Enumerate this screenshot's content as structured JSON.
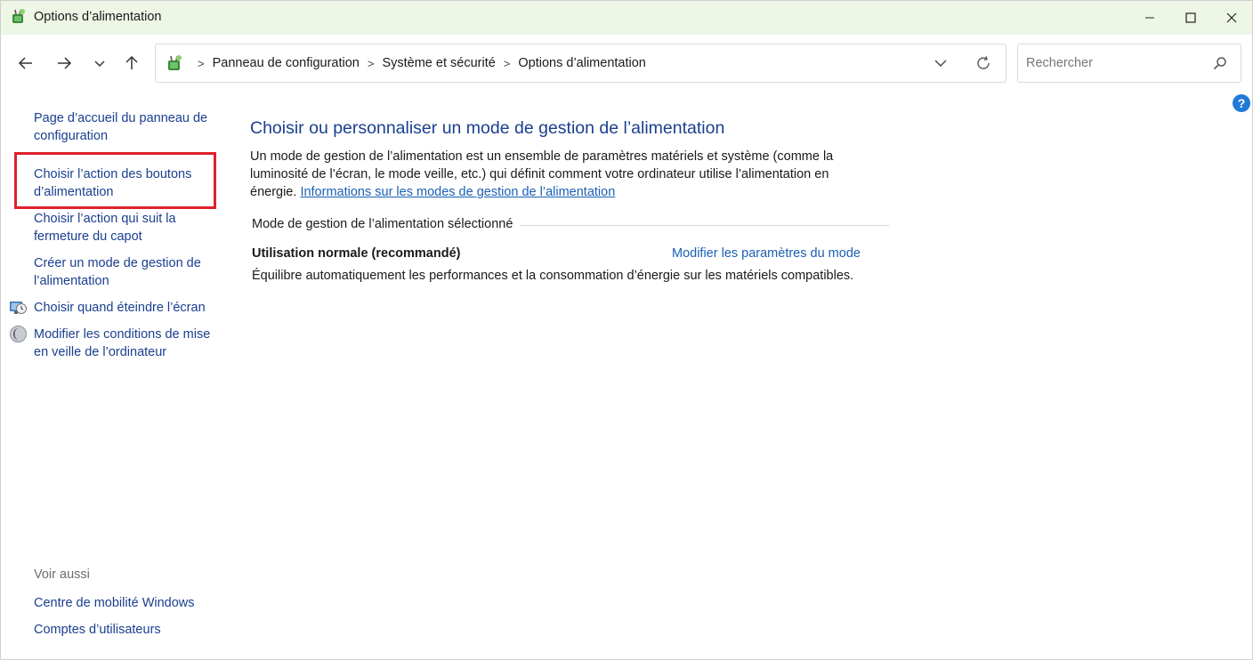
{
  "window": {
    "title": "Options d’alimentation"
  },
  "address": {
    "crumbs": [
      "Panneau de configuration",
      "Système et sécurité",
      "Options d’alimentation"
    ],
    "separator": ">"
  },
  "search": {
    "placeholder": "Rechercher",
    "value": ""
  },
  "help": {
    "label": "?"
  },
  "sidebar": {
    "home_label": "Page d’accueil du panneau de configuration",
    "items": [
      {
        "label": "Choisir l’action des boutons d’alimentation",
        "highlighted": true
      },
      {
        "label": "Choisir l’action qui suit la fermeture du capot"
      },
      {
        "label": "Créer un mode de gestion de l’alimentation"
      },
      {
        "label": "Choisir quand éteindre l’écran",
        "icon": "display-clock-icon"
      },
      {
        "label": "Modifier les conditions de mise en veille de l’ordinateur",
        "icon": "moon-icon"
      }
    ],
    "see_also_label": "Voir aussi",
    "see_also": [
      {
        "label": "Centre de mobilité Windows"
      },
      {
        "label": "Comptes d’utilisateurs"
      }
    ]
  },
  "main": {
    "title": "Choisir ou personnaliser un mode de gestion de l’alimentation",
    "description": "Un mode de gestion de l’alimentation est un ensemble de paramètres matériels et système (comme la luminosité de l’écran, le mode veille, etc.) qui définit comment votre ordinateur utilise l’alimentation en énergie.",
    "description_link": "Informations sur les modes de gestion de l’alimentation",
    "section_label": "Mode de gestion de l’alimentation sélectionné",
    "plan": {
      "name": "Utilisation normale (recommandé)",
      "change_link": "Modifier les paramètres du mode",
      "description": "Équilibre automatiquement les performances et la consommation d’énergie sur les matériels compatibles."
    }
  },
  "colors": {
    "titlebar_bg": "#eef6e6",
    "link": "#1a3f8f",
    "link_light": "#1a5fb4",
    "highlight": "#e0202c"
  }
}
